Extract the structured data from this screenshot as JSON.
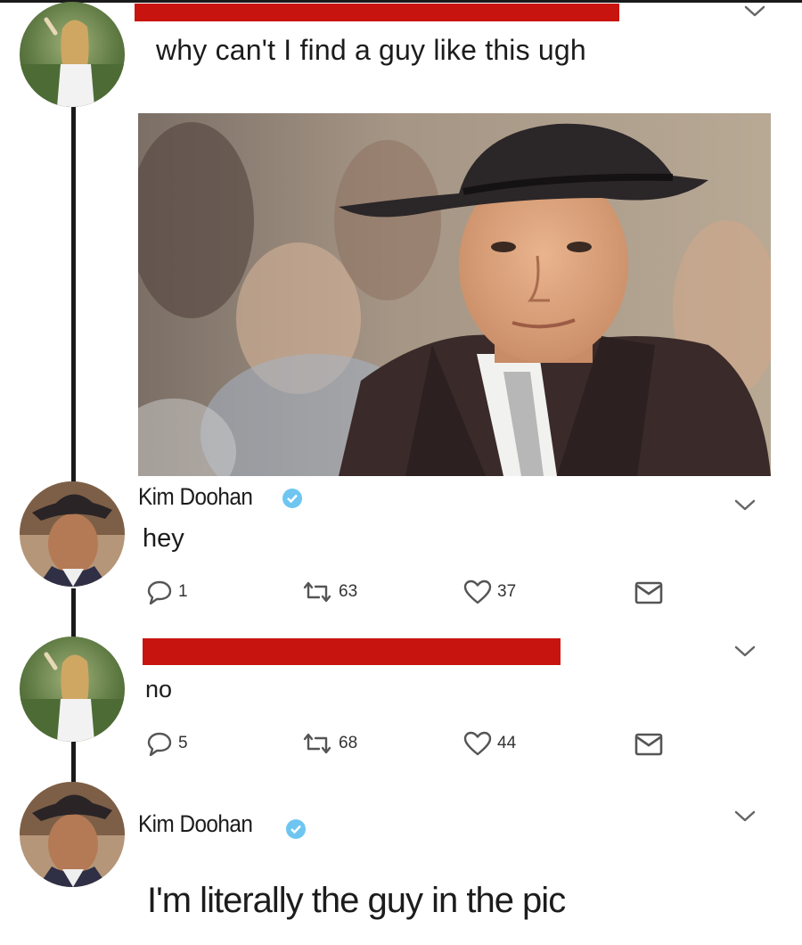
{
  "thread": {
    "tweet1": {
      "text": "why can't I find a guy like this ugh",
      "photo": "man-in-fedora-photo"
    },
    "reply1": {
      "author": "Kim Doohan",
      "text": "hey",
      "stats": {
        "replies": "1",
        "retweets": "63",
        "likes": "37"
      }
    },
    "tweet2": {
      "text": "no",
      "stats": {
        "replies": "5",
        "retweets": "68",
        "likes": "44"
      }
    },
    "reply2": {
      "author": "Kim Doohan",
      "text": "I'm literally the guy in the pic"
    }
  },
  "colors": {
    "redaction": "#c8140f",
    "verified": "#6ec6f0",
    "text": "#1c1c1c",
    "icon": "#555555"
  },
  "icons": [
    "chevron-down-icon",
    "verified-badge-icon",
    "reply-icon",
    "retweet-icon",
    "like-icon",
    "dm-icon"
  ]
}
